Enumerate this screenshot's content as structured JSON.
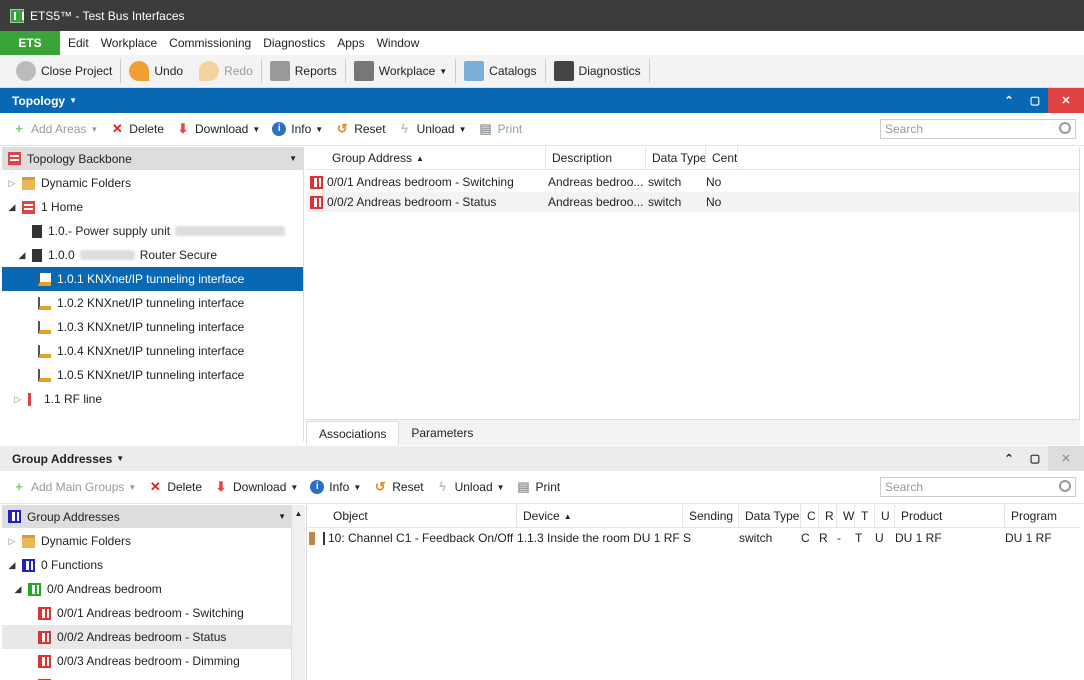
{
  "window": {
    "title": "ETS5™ - Test Bus Interfaces"
  },
  "menubar": {
    "ets": "ETS",
    "items": [
      "Edit",
      "Workplace",
      "Commissioning",
      "Diagnostics",
      "Apps",
      "Window"
    ]
  },
  "toolbar": {
    "close_project": "Close Project",
    "undo": "Undo",
    "redo": "Redo",
    "reports": "Reports",
    "workplace": "Workplace",
    "catalogs": "Catalogs",
    "diagnostics": "Diagnostics"
  },
  "topology": {
    "header": "Topology",
    "toolbar": {
      "add_areas": "Add Areas",
      "delete": "Delete",
      "download": "Download",
      "info": "Info",
      "reset": "Reset",
      "unload": "Unload",
      "print": "Print"
    },
    "search_placeholder": "Search",
    "tree_title": "Topology Backbone",
    "tree": [
      {
        "label": "Dynamic Folders"
      },
      {
        "label": "1 Home"
      },
      {
        "label": "1.0.- Power supply unit"
      },
      {
        "label": "1.0.0",
        "suffix": "Router Secure"
      },
      {
        "label": "1.0.1 KNXnet/IP tunneling interface"
      },
      {
        "label": "1.0.2 KNXnet/IP tunneling interface"
      },
      {
        "label": "1.0.3 KNXnet/IP tunneling interface"
      },
      {
        "label": "1.0.4 KNXnet/IP tunneling interface"
      },
      {
        "label": "1.0.5 KNXnet/IP tunneling interface"
      },
      {
        "label": "1.1 RF line"
      }
    ],
    "grid": {
      "columns": [
        "Group Address",
        "Description",
        "Data Type",
        "Cent"
      ],
      "rows": [
        [
          "0/0/1 Andreas bedroom - Switching",
          "Andreas bedroo...",
          "switch",
          "No"
        ],
        [
          "0/0/2 Andreas bedroom - Status",
          "Andreas bedroo...",
          "switch",
          "No"
        ]
      ]
    },
    "tabs": [
      "Associations",
      "Parameters"
    ]
  },
  "group_addresses": {
    "header": "Group Addresses",
    "toolbar": {
      "add_main_groups": "Add Main Groups",
      "delete": "Delete",
      "download": "Download",
      "info": "Info",
      "reset": "Reset",
      "unload": "Unload",
      "print": "Print"
    },
    "search_placeholder": "Search",
    "tree_title": "Group Addresses",
    "tree": [
      {
        "label": "Dynamic Folders"
      },
      {
        "label": "0 Functions"
      },
      {
        "label": "0/0 Andreas bedroom"
      },
      {
        "label": "0/0/1 Andreas bedroom - Switching"
      },
      {
        "label": "0/0/2 Andreas bedroom - Status"
      },
      {
        "label": "0/0/3 Andreas bedroom - Dimming"
      }
    ],
    "grid": {
      "columns": [
        "Object",
        "Device",
        "Sending",
        "Data Type",
        "C",
        "R",
        "W",
        "T",
        "U",
        "Product",
        "Program"
      ],
      "rows": [
        [
          "10: Channel C1 - Feedback On/Off",
          "1.1.3 Inside the room DU 1 RF",
          "S",
          "switch",
          "C",
          "R",
          "-",
          "T",
          "U",
          "DU 1 RF",
          "DU 1 RF"
        ]
      ]
    }
  }
}
